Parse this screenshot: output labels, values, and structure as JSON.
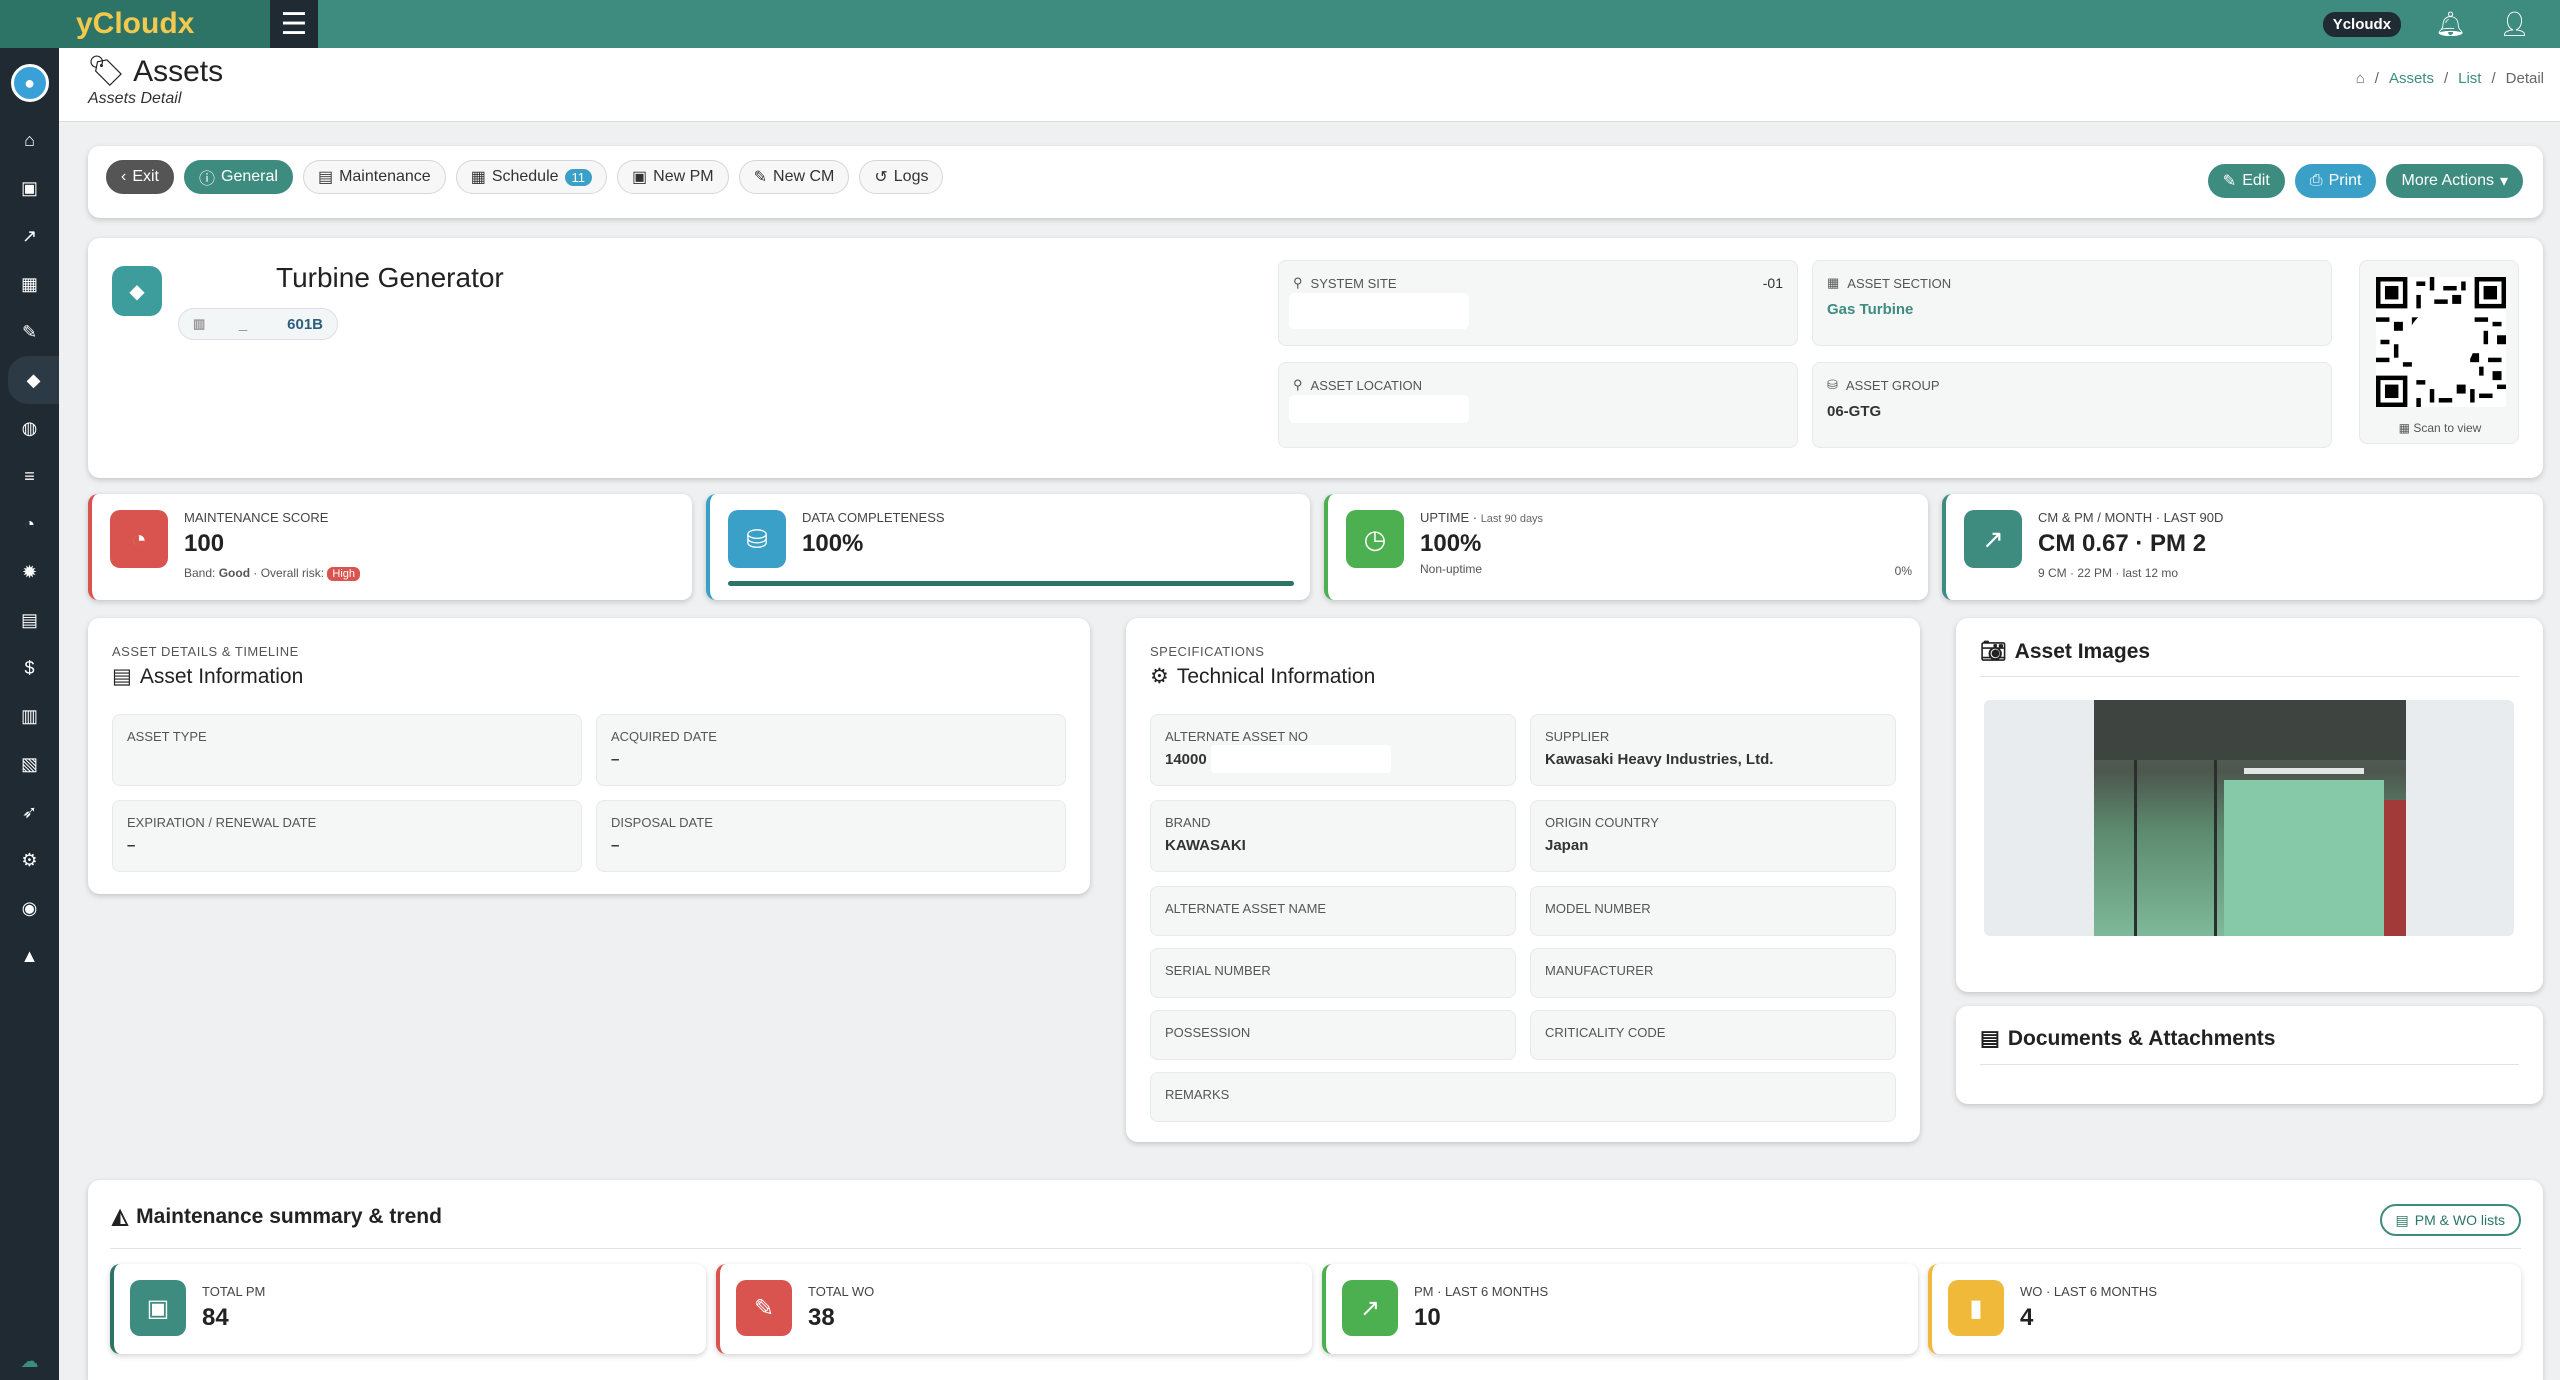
{
  "app": {
    "brand": "yCloudx",
    "user": "Ycloudx"
  },
  "page": {
    "title": "Assets",
    "subtitle": "Assets Detail"
  },
  "breadcrumb": [
    "Assets",
    "List",
    "Detail"
  ],
  "toolbar": {
    "exit": "Exit",
    "general": "General",
    "maintenance": "Maintenance",
    "schedule": "Schedule",
    "schedule_count": "11",
    "new_pm": "New PM",
    "new_cm": "New CM",
    "logs": "Logs",
    "edit": "Edit",
    "print": "Print",
    "more_actions": "More Actions"
  },
  "asset": {
    "name": "Turbine Generator",
    "code_prefix": "_",
    "code": "601B",
    "system_site_label": "SYSTEM SITE",
    "system_site_right": "-01",
    "asset_section_label": "ASSET SECTION",
    "asset_section": "Gas Turbine",
    "asset_location_label": "ASSET LOCATION",
    "asset_group_label": "ASSET GROUP",
    "asset_group": "06-GTG",
    "qr_caption": "Scan to view"
  },
  "stats": {
    "maintenance_score": {
      "label": "MAINTENANCE SCORE",
      "value": "100",
      "band_label": "Band:",
      "band": "Good",
      "risk_label": "Overall risk:",
      "risk": "High"
    },
    "data_completeness": {
      "label": "DATA COMPLETENESS",
      "value": "100%",
      "progress": 1.0
    },
    "uptime": {
      "label": "UPTIME",
      "period": "Last 90 days",
      "value": "100%",
      "sub": "Non-uptime",
      "right": "0%"
    },
    "cm_pm": {
      "label": "CM & PM / MONTH · LAST 90D",
      "value": "CM 0.67 · PM 2",
      "sub": "9 CM · 22 PM · last 12 mo"
    }
  },
  "asset_info": {
    "kicker": "ASSET DETAILS & TIMELINE",
    "title": "Asset Information",
    "asset_type_label": "ASSET TYPE",
    "asset_type": "",
    "acquired_label": "ACQUIRED DATE",
    "acquired": "–",
    "expiration_label": "EXPIRATION / RENEWAL DATE",
    "expiration": "–",
    "disposal_label": "DISPOSAL DATE",
    "disposal": "–"
  },
  "tech_info": {
    "kicker": "SPECIFICATIONS",
    "title": "Technical Information",
    "alt_no_label": "ALTERNATE ASSET NO",
    "alt_no": "14000",
    "supplier_label": "SUPPLIER",
    "supplier": "Kawasaki Heavy Industries, Ltd.",
    "brand_label": "BRAND",
    "brand": "KAWASAKI",
    "origin_label": "ORIGIN COUNTRY",
    "origin": "Japan",
    "alt_name_label": "ALTERNATE ASSET NAME",
    "model_label": "MODEL NUMBER",
    "serial_label": "SERIAL NUMBER",
    "manufacturer_label": "MANUFACTURER",
    "possession_label": "POSSESSION",
    "criticality_label": "CRITICALITY CODE",
    "remarks_label": "REMARKS"
  },
  "images": {
    "title": "Asset Images"
  },
  "documents": {
    "title": "Documents & Attachments"
  },
  "summary": {
    "title": "Maintenance summary & trend",
    "lists_button": "PM & WO lists",
    "total_pm_label": "TOTAL PM",
    "total_pm": "84",
    "total_wo_label": "TOTAL WO",
    "total_wo": "38",
    "pm6_label": "PM · LAST 6 MONTHS",
    "pm6": "10",
    "wo6_label": "WO · LAST 6 MONTHS",
    "wo6": "4"
  }
}
